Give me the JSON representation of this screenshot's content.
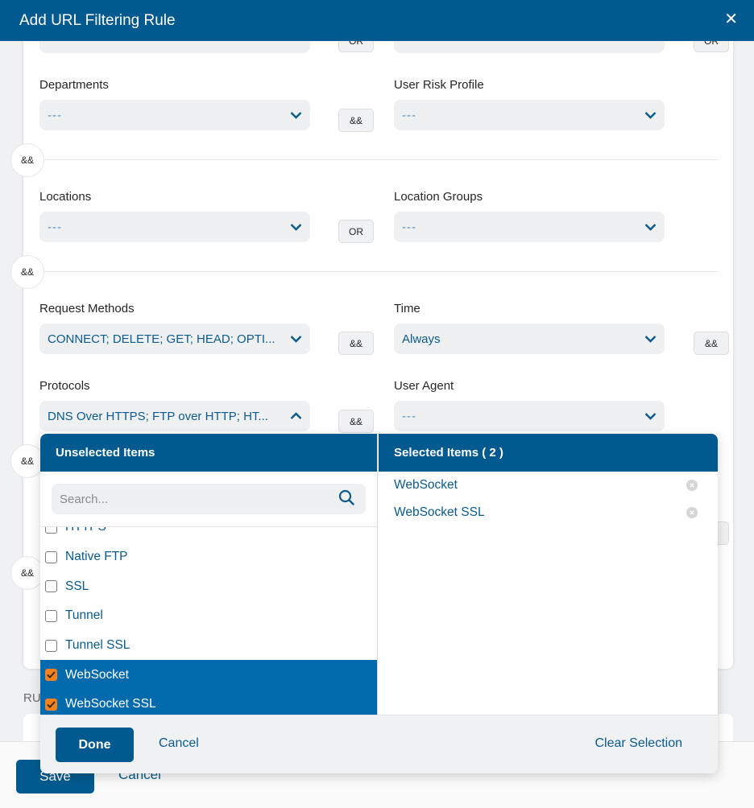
{
  "modal": {
    "title": "Add URL Filtering Rule",
    "close_icon": "close-x-icon"
  },
  "operators": {
    "or": "OR",
    "and": "&&"
  },
  "fields": {
    "departments": {
      "label": "Departments",
      "value": "---"
    },
    "user_risk_profile": {
      "label": "User Risk Profile",
      "value": "---"
    },
    "locations": {
      "label": "Locations",
      "value": "---"
    },
    "location_groups": {
      "label": "Location Groups",
      "value": "---"
    },
    "request_methods": {
      "label": "Request Methods",
      "value": "CONNECT; DELETE; GET; HEAD; OPTI..."
    },
    "time": {
      "label": "Time",
      "value": "Always"
    },
    "protocols": {
      "label": "Protocols",
      "value": "DNS Over HTTPS; FTP over HTTP; HT..."
    },
    "user_agent": {
      "label": "User Agent",
      "value": "---"
    }
  },
  "dropdown": {
    "unselected_header": "Unselected Items",
    "selected_header": "Selected Items ( 2 )",
    "search_placeholder": "Search...",
    "search_value": "",
    "items": [
      {
        "label": "HTTPS",
        "checked": false
      },
      {
        "label": "Native FTP",
        "checked": false
      },
      {
        "label": "SSL",
        "checked": false
      },
      {
        "label": "Tunnel",
        "checked": false
      },
      {
        "label": "Tunnel SSL",
        "checked": false
      },
      {
        "label": "WebSocket",
        "checked": true
      },
      {
        "label": "WebSocket SSL",
        "checked": true
      }
    ],
    "selected": [
      {
        "label": "WebSocket"
      },
      {
        "label": "WebSocket SSL"
      }
    ],
    "done_label": "Done",
    "cancel_label": "Cancel",
    "clear_label": "Clear Selection"
  },
  "background": {
    "ru_label": "RU"
  },
  "footer": {
    "save_label": "Save",
    "cancel_label": "Cancel"
  },
  "colors": {
    "brand": "#015a8f",
    "selected_row": "#016aad",
    "checkbox_checked": "#f5821f",
    "link": "#0b5a8c"
  }
}
